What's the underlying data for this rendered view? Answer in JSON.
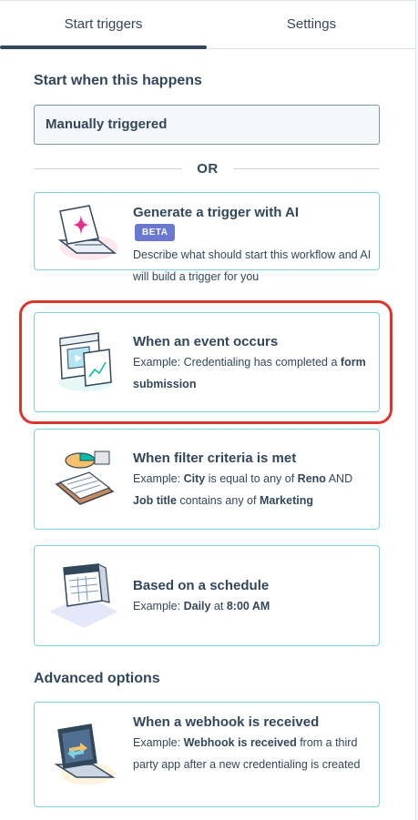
{
  "tabs": [
    {
      "label": "Start triggers",
      "active": true
    },
    {
      "label": "Settings",
      "active": false
    }
  ],
  "start_section": {
    "title": "Start when this happens",
    "selected_value": "Manually triggered",
    "divider_text": "OR"
  },
  "cards": [
    {
      "title": "Generate a trigger with AI",
      "badge": "BETA",
      "description": "Describe what should start this workflow and AI will build a trigger for you",
      "icon": "ai-laptop-illustration"
    },
    {
      "title": "When an event occurs",
      "desc_prefix": "Example: Credentialing has completed a ",
      "desc_bold": "form submission",
      "icon": "event-window-illustration",
      "highlighted": true
    },
    {
      "title": "When filter criteria is met",
      "desc_p1": "Example: ",
      "desc_b1": "City",
      "desc_p2": " is equal to any of ",
      "desc_b2": "Reno",
      "desc_p3": " AND ",
      "desc_b3": "Job title",
      "desc_p4": " contains any of ",
      "desc_b4": "Marketing",
      "icon": "filter-chart-illustration"
    },
    {
      "title": "Based on a schedule",
      "desc_p1": "Example: ",
      "desc_b1": "Daily",
      "desc_p2": " at ",
      "desc_b2": "8:00 AM",
      "icon": "calendar-illustration"
    }
  ],
  "advanced_section": {
    "title": "Advanced options",
    "card": {
      "title": "When a webhook is received",
      "desc_p1": "Example: ",
      "desc_b1": "Webhook is received",
      "desc_p2": " from a third party app after a new credentialing is created",
      "icon": "webhook-laptop-illustration"
    }
  },
  "colors": {
    "text": "#33475b",
    "card_border": "#7fd1de",
    "highlight": "#d9372b",
    "beta_badge": "#6a78d1"
  }
}
